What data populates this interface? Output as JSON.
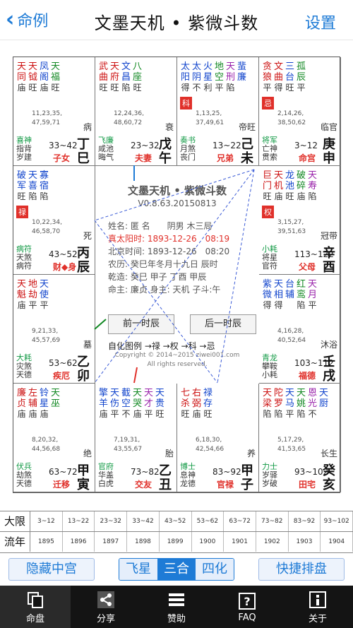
{
  "header": {
    "back_label": "命例",
    "title": "文墨天机 • 紫微斗数",
    "settings_label": "设置"
  },
  "chart": {
    "cells": [
      {
        "id": "si",
        "stars": [
          [
            "天",
            "同",
            "庙"
          ],
          [
            "天",
            "钺",
            "旺"
          ],
          [
            "凤",
            "阁",
            "庙"
          ],
          [
            "天",
            "福",
            "旺"
          ]
        ],
        "badge": "",
        "ages": "11,23,35,\n47,59,71",
        "small": "病",
        "gods": "喜神\n指背\n岁建",
        "range": "33~42",
        "palace": "子女",
        "gz": "丁巳"
      },
      {
        "id": "wu",
        "stars": [
          [
            "武",
            "曲",
            "旺"
          ],
          [
            "天",
            "府",
            "旺"
          ],
          [
            "文",
            "昌",
            "陷"
          ],
          [
            "八",
            "座",
            "旺"
          ]
        ],
        "badge": "",
        "ages": "12,24,36,\n48,60,72",
        "small": "衰",
        "gods": "飞廉\n咸池\n晦气",
        "range": "23~32",
        "palace": "夫妻",
        "gz": "戊午"
      },
      {
        "id": "wei",
        "stars": [
          [
            "太",
            "阳",
            "得"
          ],
          [
            "太",
            "阴",
            "不"
          ],
          [
            "火",
            "星",
            "利"
          ],
          [
            "地",
            "空",
            "平"
          ],
          [
            "天",
            "刑",
            "陷"
          ],
          [
            "蜚",
            "廉",
            ""
          ]
        ],
        "badge": "科",
        "ages": "1,13,25,\n37,49,61",
        "small": "帝旺",
        "gods": "奏书\n月煞\n丧门",
        "range": "13~22",
        "palace": "兄弟",
        "gz": "己未"
      },
      {
        "id": "shen",
        "stars": [
          [
            "贪",
            "狼",
            "平"
          ],
          [
            "文",
            "曲",
            "得"
          ],
          [
            "三",
            "台",
            "旺"
          ],
          [
            "孤",
            "辰",
            "平"
          ]
        ],
        "badge": "忌",
        "ages": "2,14,26,\n38,50,62",
        "small": "临官",
        "gods": "将军\n亡神\n贯索",
        "range": "3~12",
        "palace": "命宫",
        "gz": "庚申"
      },
      {
        "id": "you",
        "stars": [
          [
            "巨",
            "门",
            "旺"
          ],
          [
            "天",
            "机",
            "庙"
          ],
          [
            "龙",
            "池",
            "旺"
          ],
          [
            "破",
            "碎",
            "庙"
          ],
          [
            "天",
            "寿",
            "陷"
          ]
        ],
        "badge": "权",
        "ages": "3,15,27,\n39,51,63",
        "small": "冠带",
        "gods": "小耗\n将星\n官符",
        "range": "113~122",
        "palace": "父母",
        "gz": "辛酉"
      },
      {
        "id": "xu",
        "stars": [
          [
            "紫",
            "微",
            "得"
          ],
          [
            "天",
            "相",
            "得"
          ],
          [
            "台",
            "辅",
            ""
          ],
          [
            "红",
            "鸾",
            "陷"
          ],
          [
            "天",
            "月",
            "平"
          ]
        ],
        "badge": "",
        "ages": "4,16,28,\n40,52,64",
        "small": "沐浴",
        "gods": "青龙\n攀鞍\n小耗",
        "range": "103~112",
        "palace": "福德",
        "gz": "壬戌"
      },
      {
        "id": "hai",
        "stars": [
          [
            "天",
            "梁",
            "陷"
          ],
          [
            "陀",
            "罗",
            "陷"
          ],
          [
            "天",
            "马",
            "平"
          ],
          [
            "天",
            "姚",
            "陷"
          ],
          [
            "恩",
            "光",
            "不"
          ],
          [
            "天",
            "厨",
            ""
          ]
        ],
        "badge": "",
        "ages": "5,17,29,\n41,53,65",
        "small": "长生",
        "gods": "力士\n岁驿\n岁破",
        "range": "93~102",
        "palace": "田宅",
        "gz": "癸亥"
      },
      {
        "id": "zi",
        "stars": [
          [
            "七",
            "杀",
            "旺"
          ],
          [
            "右",
            "弼",
            "庙"
          ],
          [
            "禄",
            "存",
            "旺"
          ]
        ],
        "badge": "",
        "ages": "6,18,30,\n42,54,66",
        "small": "养",
        "gods": "博士\n息神\n龙德",
        "range": "83~92",
        "palace": "官禄",
        "gz": "甲子"
      },
      {
        "id": "chou",
        "stars": [
          [
            "擎",
            "羊",
            "庙"
          ],
          [
            "天",
            "伤",
            "平"
          ],
          [
            "截",
            "空",
            "不"
          ],
          [
            "天",
            "哭",
            "庙"
          ],
          [
            "天",
            "才",
            "平"
          ],
          [
            "天",
            "贵",
            "旺"
          ]
        ],
        "badge": "",
        "ages": "7,19,31,\n43,55,67",
        "small": "胎",
        "gods": "官府\n华盖\n白虎",
        "range": "73~82",
        "palace": "交友",
        "gz": "乙丑"
      },
      {
        "id": "yin",
        "stars": [
          [
            "廉",
            "贞",
            "庙"
          ],
          [
            "左",
            "辅",
            "庙"
          ],
          [
            "铃",
            "星",
            "庙"
          ],
          [
            "天",
            "巫",
            ""
          ]
        ],
        "badge": "",
        "ages": "8,20,32,\n44,56,68",
        "small": "绝",
        "gods": "伏兵\n劫煞\n天德",
        "range": "63~72",
        "palace": "迁移",
        "gz": "甲寅"
      },
      {
        "id": "mao",
        "stars": [
          [
            "天",
            "魁",
            "庙"
          ],
          [
            "地",
            "劫",
            "平"
          ],
          [
            "天",
            "使",
            "平"
          ]
        ],
        "badge": "",
        "ages": "9,21,33,\n45,57,69",
        "small": "墓",
        "gods": "大耗\n灾煞\n天德",
        "range": "53~62",
        "palace": "疾厄",
        "gz": "乙卯"
      },
      {
        "id": "chen",
        "stars": [
          [
            "破",
            "军",
            "旺"
          ],
          [
            "天",
            "喜",
            "陷"
          ],
          [
            "寡",
            "宿",
            "陷"
          ]
        ],
        "badge": "禄",
        "ages": "10,22,34,\n46,58,70",
        "small": "死",
        "gods": "病符\n天煞\n病符",
        "range": "43~52",
        "palace": "财◆身",
        "gz": "丙辰"
      }
    ],
    "center": {
      "title": "文墨天机 • 紫微斗数",
      "version": "V0.8.63.20150813",
      "lines": [
        "姓名: 匿 名　　阴男 木三局",
        "真太阳时: 1893-12-26　08:19",
        "北京时间: 1893-12-26　08:20",
        "农历: 癸巳年冬月十九日 辰时",
        "乾造: 癸巳 甲子 丁酉 甲辰",
        "命主: 廉贞 身主: 天机 子斗:午"
      ],
      "prev_btn": "前一时辰",
      "next_btn": "后一时辰",
      "legend": "自化图例 →禄 →权 →科 →忌",
      "copyright": "Copyright © 2014~2015 ziwei001.com",
      "rights": "All rights reserved."
    }
  },
  "table": {
    "row1_label": "大限",
    "row1": [
      "3~12",
      "13~22",
      "23~32",
      "33~42",
      "43~52",
      "53~62",
      "63~72",
      "73~82",
      "83~92",
      "93~102"
    ],
    "row2_label": "流年",
    "row2": [
      "1895",
      "1896",
      "1897",
      "1898",
      "1899",
      "1900",
      "1901",
      "1902",
      "1903",
      "1904"
    ]
  },
  "actions": {
    "hide_palace": "隐藏中宫",
    "modes": [
      "飞星",
      "三合",
      "四化"
    ],
    "active_mode": "三合",
    "quick": "快捷排盘"
  },
  "nav": [
    {
      "label": "命盘",
      "icon": "copy-icon"
    },
    {
      "label": "分享",
      "icon": "share-icon"
    },
    {
      "label": "赞助",
      "icon": "menu-icon"
    },
    {
      "label": "FAQ",
      "icon": "help-icon"
    },
    {
      "label": "关于",
      "icon": "info-icon"
    }
  ],
  "colors": {
    "accent": "#1e7bd6",
    "red": "#e0302a",
    "green": "#118822",
    "nav_bg": "#141414"
  }
}
